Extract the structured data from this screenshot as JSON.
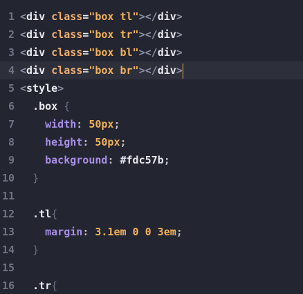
{
  "editor": {
    "lines": [
      {
        "n": "1",
        "parts": [
          [
            "punc",
            "<"
          ],
          [
            "tag",
            "div"
          ],
          [
            "sp",
            " "
          ],
          [
            "attr",
            "class"
          ],
          [
            "eq",
            "="
          ],
          [
            "str",
            "\"box tl\""
          ],
          [
            "punc",
            ">"
          ],
          [
            "punc",
            "</"
          ],
          [
            "tag",
            "div"
          ],
          [
            "punc",
            ">"
          ]
        ]
      },
      {
        "n": "2",
        "parts": [
          [
            "punc",
            "<"
          ],
          [
            "tag",
            "div"
          ],
          [
            "sp",
            " "
          ],
          [
            "attr",
            "class"
          ],
          [
            "eq",
            "="
          ],
          [
            "str",
            "\"box tr\""
          ],
          [
            "punc",
            ">"
          ],
          [
            "punc",
            "</"
          ],
          [
            "tag",
            "div"
          ],
          [
            "punc",
            ">"
          ]
        ]
      },
      {
        "n": "3",
        "parts": [
          [
            "punc",
            "<"
          ],
          [
            "tag",
            "div"
          ],
          [
            "sp",
            " "
          ],
          [
            "attr",
            "class"
          ],
          [
            "eq",
            "="
          ],
          [
            "str",
            "\"box bl\""
          ],
          [
            "punc",
            ">"
          ],
          [
            "punc",
            "</"
          ],
          [
            "tag",
            "div"
          ],
          [
            "punc",
            ">"
          ]
        ]
      },
      {
        "n": "4",
        "active": true,
        "parts": [
          [
            "punc",
            "<"
          ],
          [
            "tag",
            "div"
          ],
          [
            "sp",
            " "
          ],
          [
            "attr",
            "class"
          ],
          [
            "eq",
            "="
          ],
          [
            "str",
            "\"box br\""
          ],
          [
            "punc",
            ">"
          ],
          [
            "punc",
            "</"
          ],
          [
            "tag",
            "div"
          ],
          [
            "punc",
            ">"
          ]
        ]
      },
      {
        "n": "5",
        "parts": [
          [
            "punc",
            "<"
          ],
          [
            "tag",
            "style"
          ],
          [
            "punc",
            ">"
          ]
        ]
      },
      {
        "n": "6",
        "parts": [
          [
            "sp",
            "  "
          ],
          [
            "sel",
            ".box"
          ],
          [
            "sp",
            " "
          ],
          [
            "brace",
            "{"
          ]
        ]
      },
      {
        "n": "7",
        "parts": [
          [
            "sp",
            "    "
          ],
          [
            "prop",
            "width"
          ],
          [
            "colon",
            ":"
          ],
          [
            "sp",
            " "
          ],
          [
            "val",
            "50px"
          ],
          [
            "semi",
            ";"
          ]
        ]
      },
      {
        "n": "8",
        "parts": [
          [
            "sp",
            "    "
          ],
          [
            "prop",
            "height"
          ],
          [
            "colon",
            ":"
          ],
          [
            "sp",
            " "
          ],
          [
            "val",
            "50px"
          ],
          [
            "semi",
            ";"
          ]
        ]
      },
      {
        "n": "9",
        "parts": [
          [
            "sp",
            "    "
          ],
          [
            "prop",
            "background"
          ],
          [
            "colon",
            ":"
          ],
          [
            "sp",
            " "
          ],
          [
            "hex",
            "#fdc57b"
          ],
          [
            "semi",
            ";"
          ]
        ]
      },
      {
        "n": "10",
        "parts": [
          [
            "sp",
            "  "
          ],
          [
            "brace",
            "}"
          ]
        ]
      },
      {
        "n": "11",
        "parts": []
      },
      {
        "n": "12",
        "parts": [
          [
            "sp",
            "  "
          ],
          [
            "sel",
            ".tl"
          ],
          [
            "brace",
            "{"
          ]
        ]
      },
      {
        "n": "13",
        "parts": [
          [
            "sp",
            "    "
          ],
          [
            "prop",
            "margin"
          ],
          [
            "colon",
            ":"
          ],
          [
            "sp",
            " "
          ],
          [
            "val",
            "3.1em 0 0 3em"
          ],
          [
            "semi",
            ";"
          ]
        ]
      },
      {
        "n": "14",
        "parts": [
          [
            "sp",
            "  "
          ],
          [
            "brace",
            "}"
          ]
        ]
      },
      {
        "n": "15",
        "parts": []
      },
      {
        "n": "16",
        "parts": [
          [
            "sp",
            "  "
          ],
          [
            "sel",
            ".tr"
          ],
          [
            "brace",
            "{"
          ]
        ]
      }
    ]
  }
}
